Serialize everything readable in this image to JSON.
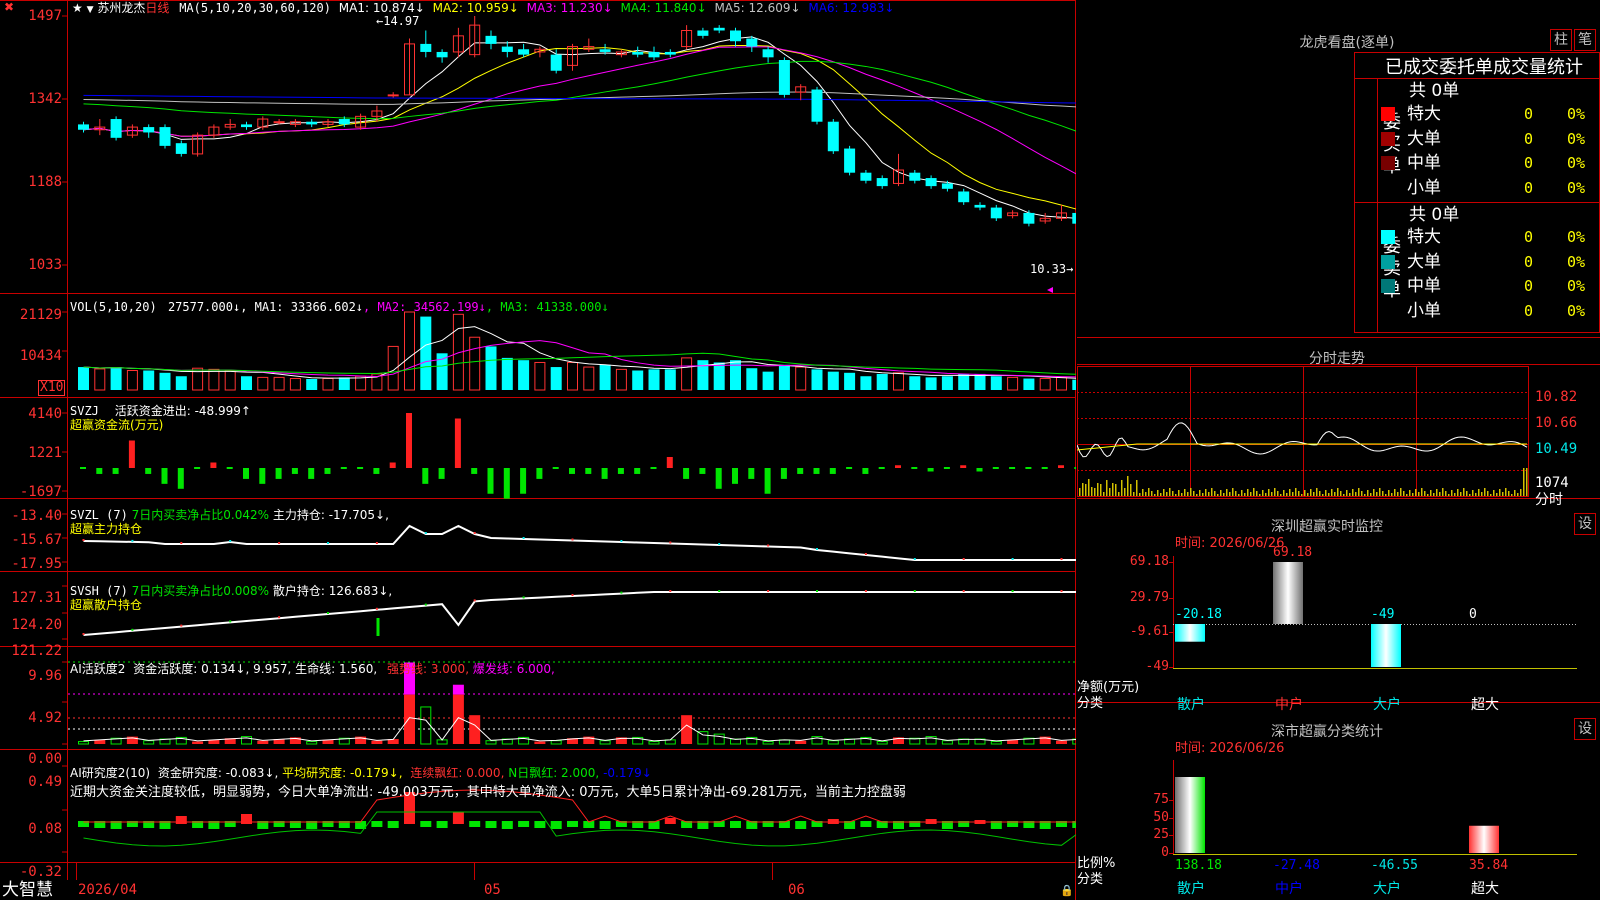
{
  "header": {
    "stock_name": "苏州龙杰",
    "period": "日线",
    "ma_title": "MA(5,10,20,30,60,120)",
    "ma": [
      {
        "label": "MA1:",
        "value": "10.874↓",
        "color": "#ffffff"
      },
      {
        "label": "MA2:",
        "value": "10.959↓",
        "color": "#ffff00"
      },
      {
        "label": "MA3:",
        "value": "11.230↓",
        "color": "#ff00ff"
      },
      {
        "label": "MA4:",
        "value": "11.840↓",
        "color": "#00e600"
      },
      {
        "label": "MA5:",
        "value": "12.609↓",
        "color": "#c0c0c0"
      },
      {
        "label": "MA6:",
        "value": "12.983↓",
        "color": "#0000ff"
      }
    ],
    "high_marker": "14.97",
    "low_marker": "10.33"
  },
  "price_axis": [
    "1497",
    "1342",
    "1188",
    "1033"
  ],
  "volume": {
    "title": "VOL(5,10,20)",
    "value": "27577.000↓",
    "ma": [
      {
        "label": "MA1:",
        "value": "33366.602↓",
        "color": "#ffffff"
      },
      {
        "label": "MA2:",
        "value": "34562.199↓",
        "color": "#ff00ff"
      },
      {
        "label": "MA3:",
        "value": "41338.000↓",
        "color": "#00e600"
      }
    ],
    "axis": [
      "21129",
      "10434"
    ],
    "unit": "X10"
  },
  "svzj": {
    "title": "SVZJ",
    "line1": "活跃资金进出: -48.999↑",
    "line2": "超赢资金流(万元)",
    "axis": [
      "4140",
      "1221",
      "-1697"
    ]
  },
  "svzl": {
    "title": "SVZL (7)",
    "ratio": "7日内买卖净占比0.042%",
    "hold": "主力持仓: -17.705↓,",
    "line2": "超赢主力持仓",
    "axis": [
      "-13.40",
      "-15.67",
      "-17.95"
    ]
  },
  "svsh": {
    "title": "SVSH (7)",
    "ratio": "7日内买卖净占比0.008%",
    "hold": "散户持仓: 126.683↓,",
    "line2": "超赢散户持仓",
    "axis": [
      "127.31",
      "124.20",
      "121.22"
    ]
  },
  "ai1": {
    "title": "AI活跃度2",
    "act": "资金活跃度: 0.134↓, 9.957,",
    "life": "生命线: 1.560,",
    "strong": "强势线: 3.000,",
    "burst": "爆发线: 6.000,",
    "axis": [
      "9.96",
      "4.92",
      "0.00"
    ]
  },
  "ai2": {
    "title": "AI研究度2(10)",
    "research": "资金研究度: -0.083↓,",
    "avg": "平均研究度: -0.179↓,",
    "cont": "连续飘红: 0.000,",
    "nday": "N日飘红: 2.000,",
    "last": "-0.179↓",
    "comment": "近期大资金关注度较低，明显弱势，今日大单净流出: -49.003万元，其中特大单净流入: 0万元，大单5日累计净出-69.281万元，当前主力控盘弱",
    "axis": [
      "0.49",
      "0.08",
      "-0.32"
    ]
  },
  "date_axis": [
    "2026/04",
    "05",
    "06"
  ],
  "brand": "大智慧",
  "lhb": {
    "title": "龙虎看盘(逐单)",
    "btn1": "柱",
    "btn2": "笔",
    "subtitle": "已成交委托单成交量统计",
    "buy_label": "委买单",
    "sell_label": "委卖单",
    "buy_total": "共 0单",
    "sell_total": "共 0单",
    "buy_rows": [
      {
        "name": "特大",
        "count": "0",
        "pct": "0%",
        "color": "#ff0000"
      },
      {
        "name": "大单",
        "count": "0",
        "pct": "0%",
        "color": "#a00000"
      },
      {
        "name": "中单",
        "count": "0",
        "pct": "0%",
        "color": "#780000"
      },
      {
        "name": "小单",
        "count": "0",
        "pct": "0%",
        "color": ""
      }
    ],
    "sell_rows": [
      {
        "name": "特大",
        "count": "0",
        "pct": "0%",
        "color": "#00ffff"
      },
      {
        "name": "大单",
        "count": "0",
        "pct": "0%",
        "color": "#00a0a0"
      },
      {
        "name": "中单",
        "count": "0",
        "pct": "0%",
        "color": "#007878"
      },
      {
        "name": "小单",
        "count": "0",
        "pct": "0%",
        "color": ""
      }
    ]
  },
  "intraday": {
    "title": "分时走势",
    "axis": [
      "10.82",
      "10.66",
      "10.49"
    ],
    "vol_label": "1074",
    "vol_unit": "分时"
  },
  "sz_monitor": {
    "title": "深圳超赢实时监控",
    "btn": "设",
    "time": "时间: 2026/06/26",
    "axis": [
      "69.18",
      "29.79",
      "-9.61",
      "-49"
    ],
    "unit": "净额(万元)",
    "cat_label": "分类",
    "bars": [
      {
        "name": "散户",
        "value": -20.18,
        "label": "-20.18",
        "color": "#00ffff"
      },
      {
        "name": "中户",
        "value": 69.18,
        "label": "69.18",
        "color": "#ff3232"
      },
      {
        "name": "大户",
        "value": -49,
        "label": "-49",
        "color": "#00ffff"
      },
      {
        "name": "超大",
        "value": 0,
        "label": "0",
        "color": "#ffffff"
      }
    ]
  },
  "sz_class": {
    "title": "深市超赢分类统计",
    "btn": "设",
    "time": "时间: 2026/06/26",
    "axis": [
      "75",
      "50",
      "25",
      "0"
    ],
    "unit": "比例%",
    "cat_label": "分类",
    "bars": [
      {
        "name": "散户",
        "value": 138.18,
        "label": "138.18",
        "label_color": "#00e600"
      },
      {
        "name": "中户",
        "value": -27.48,
        "label": "-27.48",
        "label_color": "#0000ff"
      },
      {
        "name": "大户",
        "value": -46.55,
        "label": "-46.55",
        "label_color": "#00e6e6"
      },
      {
        "name": "超大",
        "value": 35.84,
        "label": "35.84",
        "label_color": "#ff3232"
      }
    ]
  },
  "candles": [
    [
      12.95,
      12.85,
      13.0,
      12.8
    ],
    [
      12.85,
      12.9,
      13.05,
      12.75
    ],
    [
      13.05,
      12.7,
      13.1,
      12.65
    ],
    [
      12.75,
      12.9,
      12.95,
      12.7
    ],
    [
      12.9,
      12.8,
      12.95,
      12.7
    ],
    [
      12.9,
      12.55,
      12.95,
      12.5
    ],
    [
      12.6,
      12.4,
      12.65,
      12.35
    ],
    [
      12.4,
      12.75,
      12.8,
      12.35
    ],
    [
      12.75,
      12.9,
      12.95,
      12.7
    ],
    [
      12.9,
      12.95,
      13.05,
      12.85
    ],
    [
      12.95,
      12.9,
      13.0,
      12.85
    ],
    [
      12.9,
      13.05,
      13.1,
      12.85
    ],
    [
      13.0,
      13.0,
      13.05,
      12.95
    ],
    [
      12.95,
      13.0,
      13.05,
      12.9
    ],
    [
      13.0,
      12.95,
      13.05,
      12.9
    ],
    [
      12.95,
      13.0,
      13.05,
      12.9
    ],
    [
      13.05,
      12.95,
      13.1,
      12.9
    ],
    [
      12.9,
      13.1,
      13.15,
      12.85
    ],
    [
      13.1,
      13.2,
      13.3,
      13.0
    ],
    [
      13.5,
      13.5,
      13.55,
      13.45
    ],
    [
      13.5,
      14.45,
      14.55,
      13.5
    ],
    [
      14.45,
      14.3,
      14.7,
      14.2
    ],
    [
      14.3,
      14.2,
      14.35,
      14.1
    ],
    [
      14.3,
      14.6,
      14.75,
      14.2
    ],
    [
      14.25,
      14.8,
      14.97,
      14.2
    ],
    [
      14.6,
      14.45,
      14.7,
      14.35
    ],
    [
      14.4,
      14.3,
      14.5,
      14.2
    ],
    [
      14.35,
      14.25,
      14.45,
      14.2
    ],
    [
      14.3,
      14.35,
      14.4,
      14.2
    ],
    [
      14.25,
      13.95,
      14.35,
      13.9
    ],
    [
      14.05,
      14.4,
      14.45,
      13.95
    ],
    [
      14.35,
      14.4,
      14.55,
      14.3
    ],
    [
      14.35,
      14.3,
      14.45,
      14.25
    ],
    [
      14.25,
      14.3,
      14.35,
      14.2
    ],
    [
      14.3,
      14.25,
      14.4,
      14.2
    ],
    [
      14.3,
      14.2,
      14.4,
      14.15
    ],
    [
      14.3,
      14.25,
      14.35,
      14.2
    ],
    [
      14.4,
      14.7,
      14.8,
      14.35
    ],
    [
      14.7,
      14.6,
      14.75,
      14.55
    ],
    [
      14.75,
      14.7,
      14.8,
      14.65
    ],
    [
      14.7,
      14.5,
      14.75,
      14.4
    ],
    [
      14.55,
      14.4,
      14.6,
      14.3
    ],
    [
      14.35,
      14.2,
      14.4,
      14.1
    ],
    [
      14.15,
      13.5,
      14.2,
      13.45
    ],
    [
      13.55,
      13.65,
      13.7,
      13.4
    ],
    [
      13.6,
      13.0,
      13.65,
      12.95
    ],
    [
      13.0,
      12.45,
      13.05,
      12.4
    ],
    [
      12.5,
      12.05,
      12.55,
      12.0
    ],
    [
      12.05,
      11.9,
      12.1,
      11.85
    ],
    [
      11.95,
      11.8,
      12.0,
      11.75
    ],
    [
      11.85,
      12.1,
      12.4,
      11.8
    ],
    [
      12.05,
      11.9,
      12.1,
      11.85
    ],
    [
      11.95,
      11.8,
      12.0,
      11.75
    ],
    [
      11.85,
      11.75,
      11.9,
      11.7
    ],
    [
      11.7,
      11.5,
      11.75,
      11.45
    ],
    [
      11.45,
      11.4,
      11.5,
      11.35
    ],
    [
      11.4,
      11.2,
      11.45,
      11.15
    ],
    [
      11.25,
      11.3,
      11.35,
      11.2
    ],
    [
      11.3,
      11.1,
      11.35,
      11.05
    ],
    [
      11.15,
      11.2,
      11.3,
      11.1
    ],
    [
      11.2,
      11.3,
      11.45,
      11.15
    ],
    [
      11.3,
      11.1,
      11.35,
      11.05
    ],
    [
      11.1,
      11.0,
      11.15,
      10.95
    ],
    [
      11.0,
      10.95,
      11.1,
      10.85
    ],
    [
      10.95,
      11.2,
      11.35,
      10.9
    ],
    [
      11.15,
      11.05,
      11.2,
      11.0
    ],
    [
      11.05,
      10.85,
      11.1,
      10.8
    ],
    [
      10.85,
      10.7,
      10.9,
      10.6
    ]
  ],
  "volumes": [
    1.0,
    0.92,
    1.0,
    0.85,
    0.85,
    0.75,
    0.6,
    0.95,
    0.9,
    0.85,
    0.6,
    0.55,
    0.55,
    0.5,
    0.48,
    0.5,
    0.55,
    0.6,
    0.7,
    1.9,
    3.4,
    3.2,
    1.6,
    3.3,
    2.3,
    1.9,
    1.4,
    1.3,
    1.2,
    1.0,
    1.2,
    1.0,
    1.1,
    0.9,
    0.85,
    0.9,
    0.9,
    1.4,
    1.3,
    1.2,
    1.3,
    0.95,
    0.8,
    1.1,
    1.0,
    0.9,
    0.8,
    0.75,
    0.6,
    0.7,
    0.75,
    0.6,
    0.55,
    0.6,
    0.7,
    0.7,
    0.6,
    0.55,
    0.5,
    0.5,
    0.55,
    0.45,
    0.45,
    0.5,
    0.45,
    0.5,
    0.45,
    0.4
  ],
  "flow": [
    0,
    -0.1,
    -0.1,
    0.5,
    -0.1,
    -0.3,
    -0.4,
    0,
    0.1,
    0,
    -0.2,
    -0.3,
    -0.2,
    -0.1,
    -0.2,
    -0.1,
    0,
    0,
    -0.1,
    0.1,
    1.0,
    -0.3,
    -0.2,
    0.9,
    -0.1,
    -0.5,
    -0.6,
    -0.5,
    -0.2,
    0,
    -0.1,
    -0.1,
    -0.2,
    -0.1,
    -0.1,
    0,
    0.2,
    -0.2,
    -0.1,
    -0.4,
    -0.3,
    -0.2,
    -0.5,
    -0.2,
    -0.1,
    -0.1,
    -0.1,
    0,
    -0.1,
    0,
    0.05,
    0,
    -0.05,
    0,
    0.05,
    -0.05,
    0,
    0,
    0,
    0,
    0.05,
    0,
    0,
    0,
    0,
    0,
    0,
    0
  ]
}
